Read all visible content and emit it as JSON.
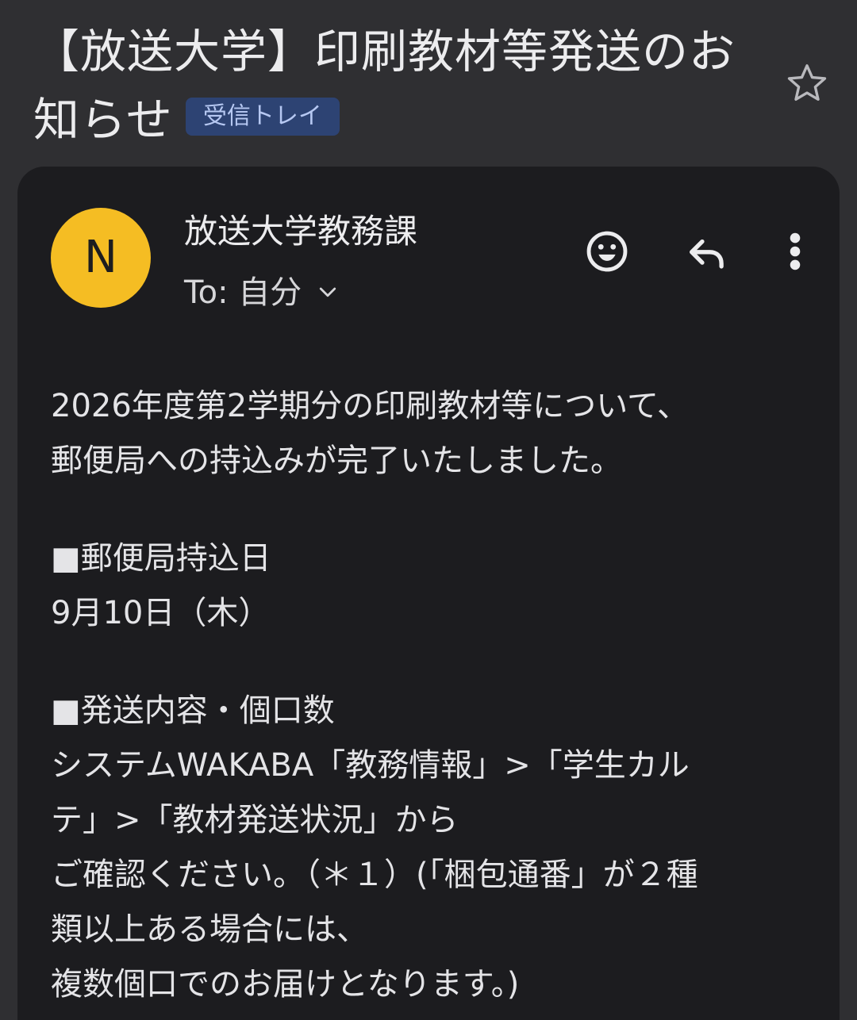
{
  "email": {
    "subject": "【放送大学】印刷教材等発送のお知らせ",
    "label": "受信トレイ",
    "sender": {
      "avatar_letter": "N",
      "name": "放送大学教務課",
      "recipient": "To: 自分"
    },
    "body": {
      "intro_line1": "2026年度第2学期分の印刷教材等について、",
      "intro_line2": "郵便局への持込みが完了いたしました。",
      "section1_heading": "■郵便局持込日",
      "section1_value": "9月10日（木）",
      "section2_heading": "■発送内容・個口数",
      "section2_line1": "システムWAKABA「教務情報」>「学生カル",
      "section2_line2": "テ」>「教材発送状況」から",
      "section2_line3": "ご確認ください。（＊１）(「梱包通番」が２種",
      "section2_line4": "類以上ある場合には、",
      "section2_line5": "複数個口でのお届けとなります。)"
    }
  },
  "icons": {
    "star": "star-outline-icon",
    "emoji": "emoji-icon",
    "reply": "reply-icon",
    "more": "more-vert-icon",
    "chevron": "chevron-down-icon"
  },
  "colors": {
    "background": "#2f2f32",
    "card": "#1c1c1f",
    "avatar": "#f5bd23",
    "label_bg": "#2d4373",
    "label_text": "#b6c8f2"
  }
}
